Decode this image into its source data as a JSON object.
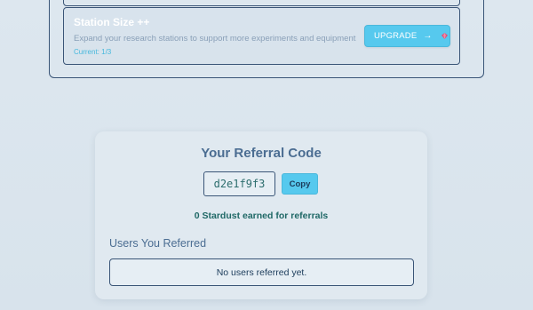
{
  "upgrade": {
    "title": "Station Size ++",
    "description": "Expand your research stations to support more experiments and equipment",
    "current": "Current: 1/3",
    "button_label": "UPGRADE",
    "arrow": "→"
  },
  "referral": {
    "title": "Your Referral Code",
    "code": "d2e1f9f3",
    "copy_label": "Copy",
    "earned": "0 Stardust earned for referrals",
    "referred_heading": "Users You Referred",
    "referred_empty": "No users referred yet."
  },
  "colors": {
    "accent": "#56c9ee",
    "border": "#3a5577",
    "heading": "#4b6d92",
    "teal_text": "#1f6866"
  },
  "icons": {
    "arrow": "arrow-right-icon",
    "gem": "gem-icon"
  }
}
